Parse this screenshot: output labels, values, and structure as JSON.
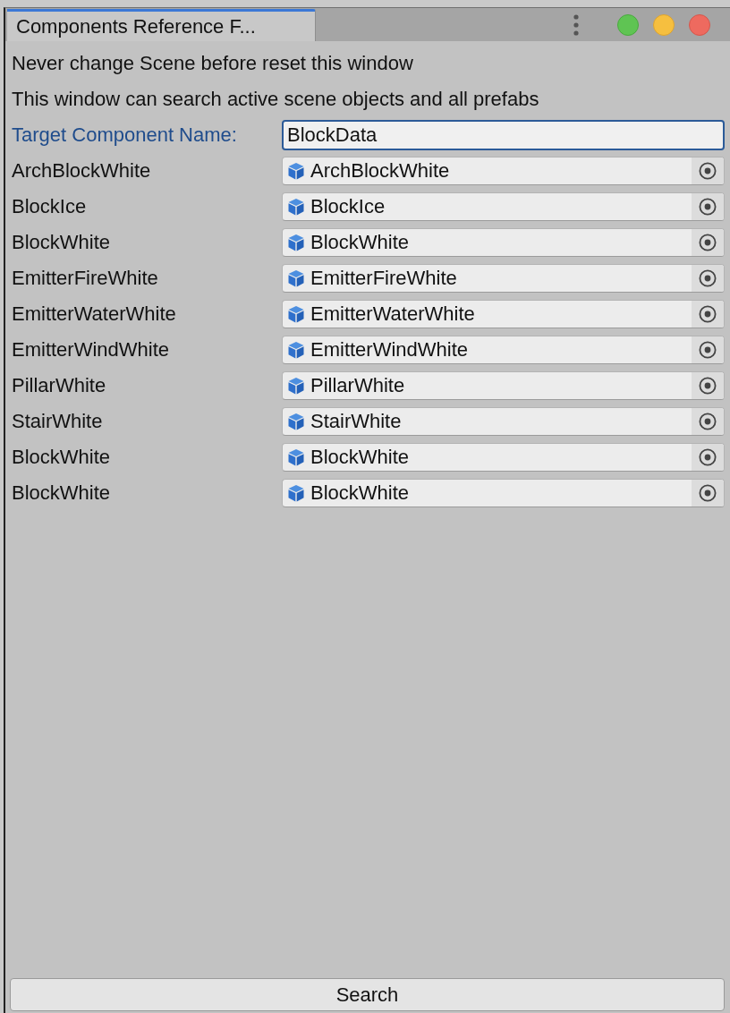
{
  "tabs": [
    {
      "title": "Components Reference F...",
      "selected": true
    }
  ],
  "notes": [
    "Never change Scene before reset this window",
    "This window can search active scene objects and all prefabs"
  ],
  "target_field": {
    "label": "Target Component Name:",
    "value": "BlockData",
    "focused": true
  },
  "results": [
    {
      "name": "ArchBlockWhite",
      "object": "ArchBlockWhite"
    },
    {
      "name": "BlockIce",
      "object": "BlockIce"
    },
    {
      "name": "BlockWhite",
      "object": "BlockWhite"
    },
    {
      "name": "EmitterFireWhite",
      "object": "EmitterFireWhite"
    },
    {
      "name": "EmitterWaterWhite",
      "object": "EmitterWaterWhite"
    },
    {
      "name": "EmitterWindWhite",
      "object": "EmitterWindWhite"
    },
    {
      "name": "PillarWhite",
      "object": "PillarWhite"
    },
    {
      "name": "StairWhite",
      "object": "StairWhite"
    },
    {
      "name": "BlockWhite",
      "object": "BlockWhite"
    },
    {
      "name": "BlockWhite",
      "object": "BlockWhite"
    }
  ],
  "search_button": "Search"
}
